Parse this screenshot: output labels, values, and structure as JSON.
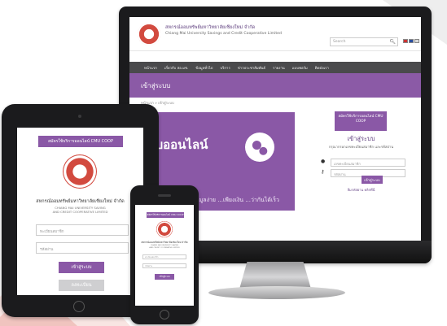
{
  "colors": {
    "brand_purple": "#8a58a6",
    "nav_dark": "#4a4a4c",
    "device_frame": "#1b1b1d",
    "seal_red": "#d24a3f"
  },
  "desktop": {
    "header": {
      "brand_th": "สหกรณ์ออมทรัพย์มหาวิทยาลัยเชียงใหม่ จำกัด",
      "brand_en": "Chiang Mai University Savings and Credit Cooperative Limited",
      "search_placeholder": "Search",
      "search_icon": "magnifier-icon"
    },
    "nav": [
      "หน้าแรก",
      "เกี่ยวกับ สอ.มช.",
      "ข้อมูลทั่วไป",
      "บริการ",
      "ข่าวประชาสัมพันธ์",
      "รายงาน",
      "แบบฟอร์ม",
      "ติดต่อเรา"
    ],
    "banner_title": "เข้าสู่ระบบ",
    "breadcrumb": "หน้าแรก » เข้าสู่ระบบ",
    "hero": {
      "title": "ระบบออนไลน์",
      "footer": "...ข้อมูลง่าย ...เพียงเงิน ...ว่ากันได้เร็ว",
      "icon": "globe-icon"
    },
    "login": {
      "service_button": "สมัครใช้บริการออนไลน์ CMU COOP",
      "title": "เข้าสู่ระบบ",
      "hint": "กรุณากรอกเลขทะเบียนสมาชิก และรหัสผ่าน",
      "username_placeholder": "เลขทะเบียนสมาชิก",
      "password_placeholder": "รหัสผ่าน",
      "submit": "เข้าสู่ระบบ",
      "forgot": "ลืมรหัสผ่าน คลิกที่นี่",
      "user_icon": "user-icon",
      "key_icon": "key-icon"
    }
  },
  "tablet": {
    "service_button": "สมัครใช้บริการออนไลน์ CMU COOP",
    "org_th": "สหกรณ์ออมทรัพย์มหาวิทยาลัยเชียงใหม่ จำกัด",
    "org_en1": "CHIANG MAI UNIVERSITY SAVING",
    "org_en2": "AND CREDIT COOPERATIVE LIMITED",
    "username_placeholder": "ทะเบียนสมาชิก",
    "password_placeholder": "รหัสผ่าน",
    "submit": "เข้าสู่ระบบ",
    "register": "ลงทะเบียน"
  },
  "phone": {
    "service_button": "สมัครใช้บริการออนไลน์ CMU COOP",
    "org_th": "สหกรณ์ออมทรัพย์มหาวิทยาลัยเชียงใหม่ จำกัด",
    "org_en1": "CHIANG MAI UNIVERSITY SAVING",
    "org_en2": "AND CREDIT COOPERATIVE LIMITED",
    "username_placeholder": "ทะเบียนสมาชิก",
    "password_placeholder": "รหัสผ่าน",
    "submit": "เข้าสู่ระบบ"
  }
}
